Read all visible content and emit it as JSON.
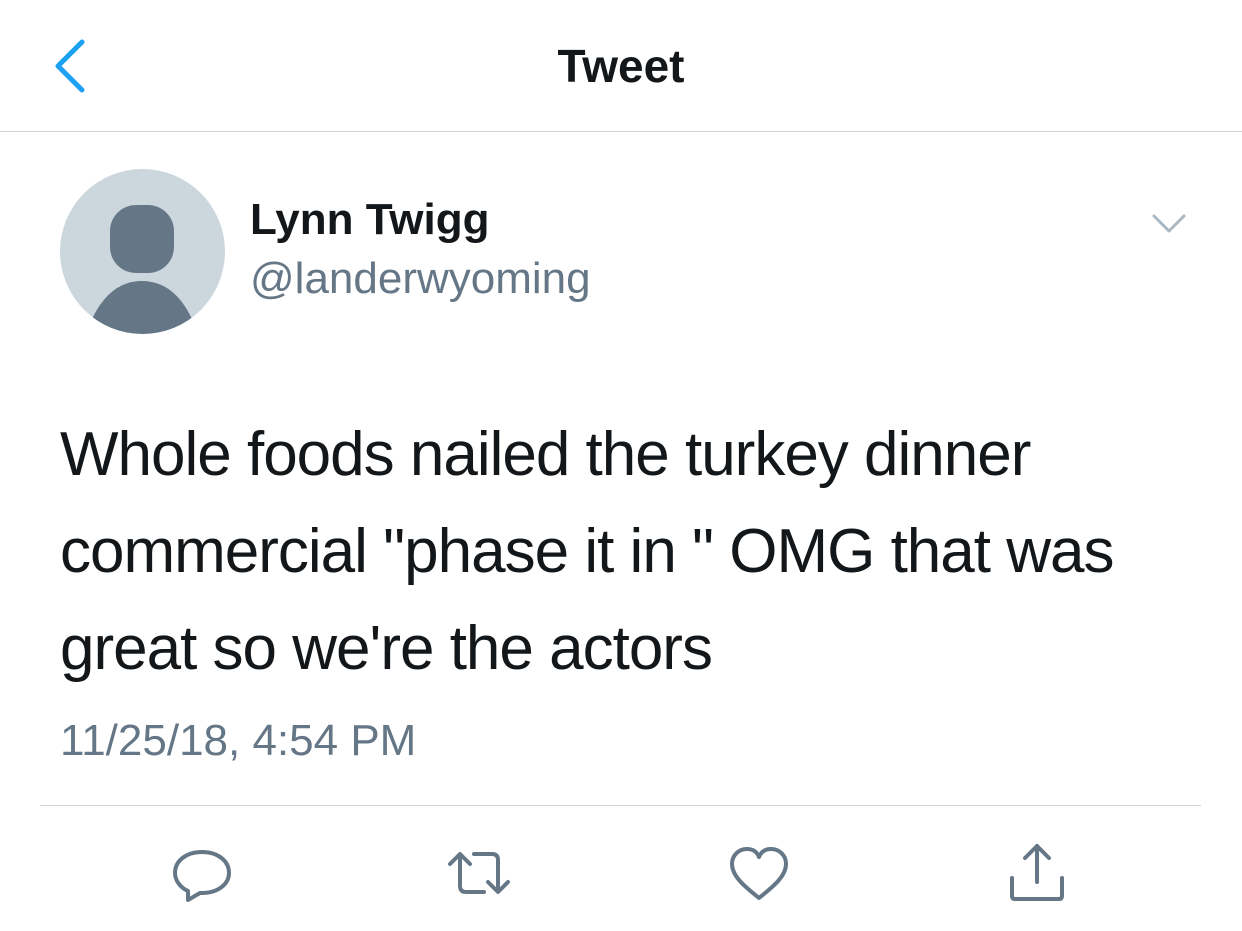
{
  "header": {
    "title": "Tweet",
    "back_icon": "chevron-left-icon"
  },
  "colors": {
    "accent": "#1da1f2",
    "text_primary": "#14171a",
    "text_secondary": "#657786",
    "icon_gray": "#657786",
    "avatar_bg": "#ccd6dd",
    "divider": "#cfd3d6"
  },
  "tweet": {
    "author": {
      "display_name": "Lynn Twigg",
      "handle": "@landerwyoming",
      "avatar_icon": "default-avatar-icon"
    },
    "menu_icon": "chevron-down-icon",
    "text": "Whole foods nailed the turkey dinner\ncommercial \"phase it in \" OMG that was\ngreat so we're the actors",
    "timestamp": "11/25/18, 4:54 PM"
  },
  "actions": [
    {
      "name": "reply",
      "icon": "reply-icon"
    },
    {
      "name": "retweet",
      "icon": "retweet-icon"
    },
    {
      "name": "like",
      "icon": "heart-icon"
    },
    {
      "name": "share",
      "icon": "share-icon"
    }
  ]
}
